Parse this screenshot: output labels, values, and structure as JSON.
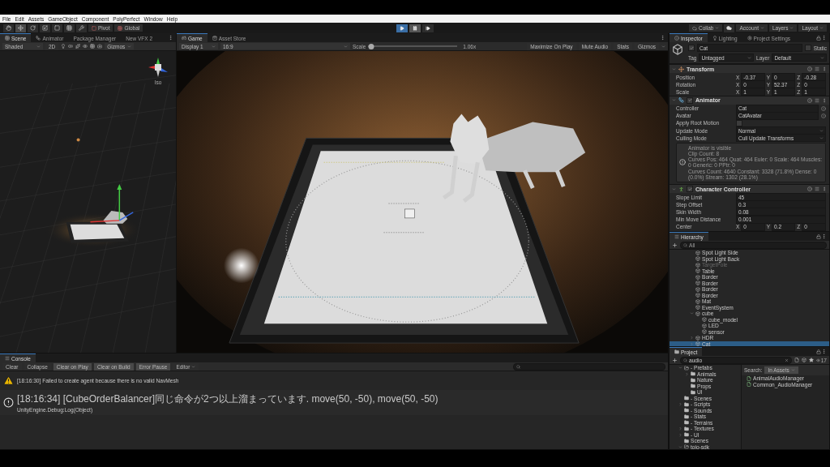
{
  "menu": [
    "File",
    "Edit",
    "Assets",
    "GameObject",
    "Component",
    "PolyPerfect",
    "Window",
    "Help"
  ],
  "toolbar": {
    "tools": [
      {
        "kind": "hand",
        "selected": false
      },
      {
        "kind": "move",
        "selected": true
      },
      {
        "kind": "rotate",
        "selected": false
      },
      {
        "kind": "scale",
        "selected": false
      },
      {
        "kind": "rect",
        "selected": false
      },
      {
        "kind": "transform",
        "selected": false
      },
      {
        "kind": "custom",
        "selected": false
      }
    ],
    "pivot": "Pivot",
    "space": "Global",
    "playback": [
      {
        "kind": "play",
        "on": true
      },
      {
        "kind": "pause",
        "on": true
      },
      {
        "kind": "step",
        "on": false
      }
    ],
    "collab": "Collab",
    "account": "Account",
    "layers": "Layers",
    "layout": "Layout"
  },
  "scene_panel": {
    "tabs": [
      {
        "label": "Scene",
        "kind": "scene",
        "selected": true
      },
      {
        "label": "Animator",
        "kind": "animator",
        "selected": false
      },
      {
        "label": "Package Manager",
        "kind": "plain",
        "selected": false
      },
      {
        "label": "New VFX 2",
        "kind": "plain",
        "selected": false
      }
    ],
    "shading": "Shaded",
    "mode_2d": "2D",
    "gizmos": "Gizmos",
    "view_label": "Iso"
  },
  "game_panel": {
    "tabs": [
      {
        "label": "Game",
        "kind": "game",
        "selected": true
      },
      {
        "label": "Asset Store",
        "kind": "store",
        "selected": false
      }
    ],
    "display": "Display 1",
    "aspect": "16:9",
    "scale_label": "Scale",
    "scale": {
      "level": 0.03,
      "reading": "1.06x"
    },
    "options": [
      {
        "label": "Maximize On Play",
        "on": false
      },
      {
        "label": "Mute Audio",
        "on": false
      },
      {
        "label": "Stats",
        "on": false
      },
      {
        "label": "Gizmos",
        "on": false
      }
    ]
  },
  "inspector": {
    "tabs": [
      {
        "label": "Inspector",
        "kind": "inspector",
        "selected": true
      },
      {
        "label": "Lighting",
        "kind": "lighting",
        "selected": false
      },
      {
        "label": "Project Settings",
        "kind": "settings",
        "selected": false
      }
    ],
    "object": {
      "name": "Cat",
      "active": true,
      "static_label": "Static",
      "static": false,
      "tag_label": "Tag",
      "tag": "Untagged",
      "layer_label": "Layer",
      "layer": "Default"
    },
    "components": [
      {
        "kind": "transform",
        "title": "Transform",
        "rows": [
          {
            "kind": "vector",
            "label": "Position",
            "values": [
              {
                "axis": "X",
                "value": "-0.37"
              },
              {
                "axis": "Y",
                "value": "0"
              },
              {
                "axis": "Z",
                "value": "-0.28"
              }
            ]
          },
          {
            "kind": "vector",
            "label": "Rotation",
            "values": [
              {
                "axis": "X",
                "value": "0"
              },
              {
                "axis": "Y",
                "value": "52.37"
              },
              {
                "axis": "Z",
                "value": "0"
              }
            ]
          },
          {
            "kind": "vector",
            "label": "Scale",
            "values": [
              {
                "axis": "X",
                "value": "1"
              },
              {
                "axis": "Y",
                "value": "1"
              },
              {
                "axis": "Z",
                "value": "1"
              }
            ]
          }
        ]
      },
      {
        "kind": "animator",
        "title": "Animator",
        "enabled": true,
        "rows": [
          {
            "kind": "object",
            "label": "Controller",
            "value": "Cat"
          },
          {
            "kind": "object",
            "label": "Avatar",
            "value": "CatAvatar"
          },
          {
            "kind": "toggle",
            "label": "Apply Root Motion",
            "checked": false
          },
          {
            "kind": "dropdown",
            "label": "Update Mode",
            "value": "Normal"
          },
          {
            "kind": "dropdown",
            "label": "Culling Mode",
            "value": "Cull Update Transforms"
          },
          {
            "kind": "info",
            "lines": [
              "Animator is visible",
              "Clip Count: 8",
              "Curves Pos: 464 Quat: 464 Euler: 0 Scale: 464 Muscles: 0 Generic: 0 PPtr: 0",
              "Curves Count: 4640 Constant: 3328 (71.8%) Dense: 0 (0.0%) Stream: 1302 (28.1%)"
            ]
          }
        ]
      },
      {
        "kind": "character_controller",
        "title": "Character Controller",
        "enabled": true,
        "rows": [
          {
            "kind": "text",
            "label": "Slope Limit",
            "value": "45"
          },
          {
            "kind": "text",
            "label": "Step Offset",
            "value": "0.3"
          },
          {
            "kind": "text",
            "label": "Skin Width",
            "value": "0.08"
          },
          {
            "kind": "text",
            "label": "Min Move Distance",
            "value": "0.001"
          },
          {
            "kind": "vector",
            "label": "Center",
            "values": [
              {
                "axis": "X",
                "value": "0"
              },
              {
                "axis": "Y",
                "value": "0.2"
              },
              {
                "axis": "Z",
                "value": "0"
              }
            ]
          }
        ]
      }
    ]
  },
  "hierarchy": {
    "title": "Hierarchy",
    "search_placeholder": "All",
    "items": [
      {
        "label": "Spot Light Side",
        "selected": false,
        "disabled": false
      },
      {
        "label": "Spot Light Back",
        "selected": false,
        "disabled": false
      },
      {
        "label": "TargetPole",
        "selected": false,
        "disabled": true
      },
      {
        "label": "Table",
        "selected": false,
        "disabled": false
      },
      {
        "label": "Border",
        "selected": false,
        "disabled": false
      },
      {
        "label": "Border",
        "selected": false,
        "disabled": false
      },
      {
        "label": "Border",
        "selected": false,
        "disabled": false
      },
      {
        "label": "Border",
        "selected": false,
        "disabled": false
      },
      {
        "label": "Mat",
        "selected": false,
        "disabled": false
      },
      {
        "label": "EventSystem",
        "selected": false,
        "disabled": false
      },
      {
        "label": "cube",
        "selected": false,
        "disabled": false,
        "expanded": true,
        "children": [
          {
            "label": "cube_model",
            "selected": false,
            "disabled": false
          },
          {
            "label": "LED",
            "selected": false,
            "disabled": false
          },
          {
            "label": "sensor",
            "selected": false,
            "disabled": false
          }
        ]
      },
      {
        "label": "HDR",
        "selected": false,
        "disabled": false,
        "expanded": false
      },
      {
        "label": "Cat",
        "selected": true,
        "disabled": false,
        "expanded": false
      }
    ]
  },
  "project": {
    "title": "Project",
    "search": "audio",
    "count": "17",
    "search_label": "Search:",
    "scope": "In Assets",
    "folders": [
      {
        "label": "- Prefabs",
        "selected": false,
        "expanded": true,
        "children": [
          {
            "label": "Animals",
            "selected": false,
            "expanded": false
          },
          {
            "label": "Nature",
            "selected": false
          },
          {
            "label": "Props",
            "selected": false
          },
          {
            "label": "UI",
            "selected": false
          }
        ]
      },
      {
        "label": "- Scenes",
        "selected": false
      },
      {
        "label": "- Scripts",
        "selected": false,
        "expanded": false
      },
      {
        "label": "- Sounds",
        "selected": false
      },
      {
        "label": "- Stats",
        "selected": false
      },
      {
        "label": "- Terrains",
        "selected": false
      },
      {
        "label": "- Textures",
        "selected": false,
        "expanded": false
      },
      {
        "label": "- UI",
        "selected": false,
        "expanded": false
      },
      {
        "label": "Scenes",
        "selected": false
      },
      {
        "label": "toio-sdk",
        "selected": false,
        "expanded": true
      }
    ],
    "results": [
      "AnimalAudioManager",
      "Common_AudioManager"
    ]
  },
  "console": {
    "title": "Console",
    "buttons": [
      {
        "label": "Clear",
        "on": false
      },
      {
        "label": "Collapse",
        "on": false
      },
      {
        "label": "Clear on Play",
        "on": true
      },
      {
        "label": "Clear on Build",
        "on": true
      },
      {
        "label": "Error Pause",
        "on": true
      }
    ],
    "editor": "Editor",
    "messages": [
      {
        "kind": "warning",
        "lines": [
          "[18:16:30] Failed to create agent because there is no valid NavMesh"
        ]
      },
      {
        "kind": "info",
        "lines": [
          "[18:16:34] [CubeOrderBalancer]同じ命令が2つ以上溜まっています. move(50, -50), move(50, -50)",
          "UnityEngine.Debug:Log(Object)"
        ]
      }
    ]
  }
}
